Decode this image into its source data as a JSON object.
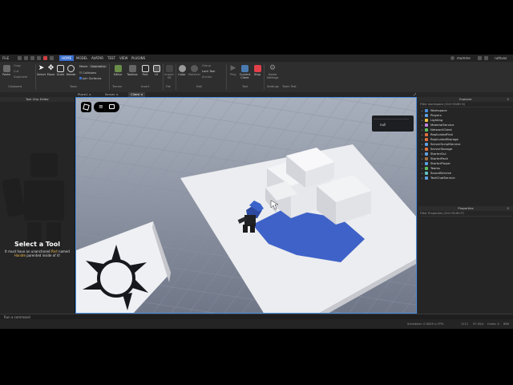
{
  "menubar": {
    "file": "FILE",
    "tabs": [
      "HOME",
      "MODEL",
      "AVATAR",
      "TEST",
      "VIEW",
      "PLUGINS"
    ],
    "active_tab": "HOME",
    "user": "mumme",
    "right_label": "ruthvez"
  },
  "ribbon": {
    "clipboard": {
      "label": "Clipboard",
      "paste": "Paste",
      "copy": "Copy",
      "cut": "Cut",
      "duplicate": "Duplicate"
    },
    "tools": {
      "label": "Tools",
      "items": [
        "Select",
        "Move",
        "Scale",
        "Rotate"
      ],
      "mode_label": "Mode:",
      "mode_value": "Geometric",
      "collisions": "Collisions",
      "join": "Join Surfaces"
    },
    "terrain": {
      "label": "Terrain",
      "items": [
        "Editor",
        "Toolbox"
      ]
    },
    "insert": {
      "label": "Insert",
      "items": [
        "Part",
        "UI"
      ]
    },
    "file": {
      "label": "File",
      "items": [
        "Import 3D"
      ]
    },
    "edit": {
      "label": "Edit",
      "items": [
        "Color",
        "Material"
      ],
      "group": "Group",
      "lock": "Lock",
      "anchor": "Anchor",
      "lock_tool": "Lock Tool"
    },
    "test": {
      "label": "Test",
      "play": "Play",
      "current_client": "Current Client",
      "stop": "Stop"
    },
    "settings": {
      "label": "Settings",
      "item": "Game Settings"
    },
    "team_test": {
      "label": "Team Test"
    }
  },
  "doc_tabs": [
    "Place1",
    "Server",
    "Client"
  ],
  "left_panel": {
    "title": "Tool Grip Editor",
    "heading": "Select a Tool",
    "desc_pre": "It must have an unanchored ",
    "desc_part": "Part",
    "desc_mid": " named",
    "desc_handle": "Handle",
    "desc_post": " parented inside of it!"
  },
  "viewport": {
    "chat_text": "null"
  },
  "explorer": {
    "title": "Explorer",
    "filter": "Filter workspace (Ctrl+Shift+X)",
    "items": [
      {
        "name": "Workspace",
        "color": "#4a90d9"
      },
      {
        "name": "Players",
        "color": "#5aa0e0"
      },
      {
        "name": "Lighting",
        "color": "#f0c040"
      },
      {
        "name": "MaterialService",
        "color": "#c080e0"
      },
      {
        "name": "NetworkClient",
        "color": "#60c060"
      },
      {
        "name": "ReplicatedFirst",
        "color": "#e07040"
      },
      {
        "name": "ReplicatedStorage",
        "color": "#e07040"
      },
      {
        "name": "ServerScriptService",
        "color": "#60a0e0"
      },
      {
        "name": "ServerStorage",
        "color": "#e07040"
      },
      {
        "name": "StarterGui",
        "color": "#60a0e0"
      },
      {
        "name": "StarterPack",
        "color": "#a07040"
      },
      {
        "name": "StarterPlayer",
        "color": "#5aa0e0"
      },
      {
        "name": "Teams",
        "color": "#60c060"
      },
      {
        "name": "SoundService",
        "color": "#60c0c0"
      },
      {
        "name": "TextChatService",
        "color": "#60a0e0"
      }
    ]
  },
  "properties": {
    "title": "Properties",
    "filter": "Filter Properties (Ctrl+Shift+P)"
  },
  "command_bar": {
    "placeholder": "Run a command"
  },
  "status": {
    "scheduler": "Scheduler: 0.0005 s; FPS:",
    "fps": "1111",
    "rate": "57.92/s",
    "cores": "Cores: 4",
    "mem": "868"
  }
}
